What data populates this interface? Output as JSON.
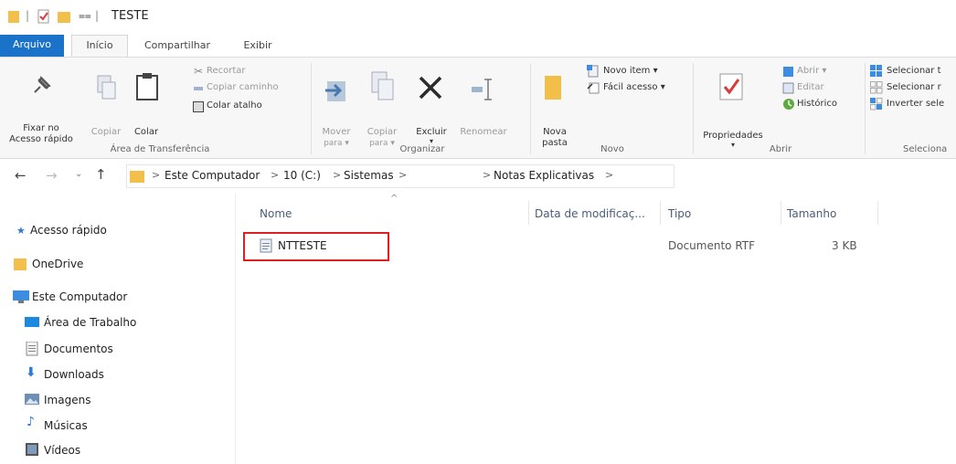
{
  "window": {
    "title": "TESTE",
    "qa_separator": "|"
  },
  "tabs": [
    {
      "label": "Arquivo"
    },
    {
      "label": "Início"
    },
    {
      "label": "Compartilhar"
    },
    {
      "label": "Exibir"
    }
  ],
  "ribbon": {
    "clipboard": {
      "pin_label_1": "Fixar no",
      "pin_label_2": "Acesso rápido",
      "copy": "Copiar",
      "paste": "Colar",
      "cut": "Recortar",
      "copy_path": "Copiar caminho",
      "paste_shortcut": "Colar atalho",
      "group": "Área de Transferência"
    },
    "organize": {
      "move_1": "Mover",
      "move_2": "para ▾",
      "copy_1": "Copiar",
      "copy_2": "para ▾",
      "delete": "Excluir",
      "delete_arrow": "▾",
      "rename": "Renomear",
      "group": "Organizar"
    },
    "new": {
      "folder_1": "Nova",
      "folder_2": "pasta",
      "new_item": "Novo item ▾",
      "easy_access": "Fácil acesso ▾",
      "group": "Novo"
    },
    "open": {
      "properties": "Propriedades",
      "properties_arrow": "▾",
      "open": "Abrir ▾",
      "edit": "Editar",
      "history": "Histórico",
      "group": "Abrir"
    },
    "select": {
      "select_all": "Selecionar t",
      "select_none": "Selecionar r",
      "invert": "Inverter sele",
      "group": "Seleciona"
    }
  },
  "address": {
    "crumbs": [
      "Este Computador",
      "10 (C:)",
      "Sistemas",
      "Notas Explicativas"
    ],
    "sep": ">"
  },
  "nav": {
    "quick_access": "Acesso rápido",
    "onedrive": "OneDrive",
    "this_pc": "Este Computador",
    "desktop": "Área de Trabalho",
    "documents": "Documentos",
    "downloads": "Downloads",
    "pictures": "Imagens",
    "music": "Músicas",
    "videos": "Vídeos"
  },
  "columns": {
    "name": "Nome",
    "modified": "Data de modificaç...",
    "type": "Tipo",
    "size": "Tamanho",
    "sort_indicator": "^"
  },
  "files": [
    {
      "name": "NTTESTE",
      "type": "Documento RTF",
      "size": "3 KB"
    }
  ],
  "colors": {
    "accent": "#1a73c9",
    "folder": "#f2c04a",
    "highlight": "#e02020"
  }
}
